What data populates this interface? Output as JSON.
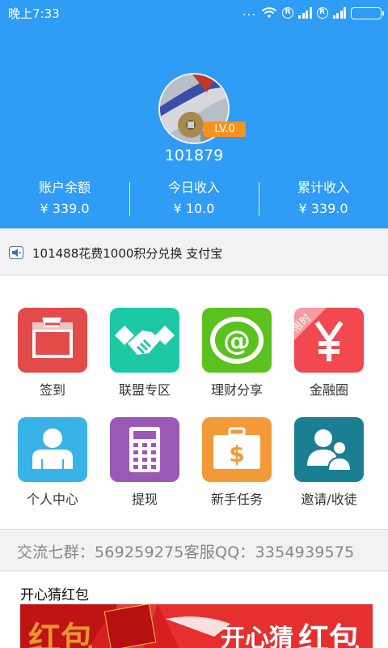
{
  "status_bar": {
    "time": "晚上7:33",
    "dots": "...",
    "r_mark": "R",
    "icons": [
      "wifi-icon",
      "signal-icon",
      "battery-icon"
    ]
  },
  "profile": {
    "level": "LV.0",
    "user_id": "101879"
  },
  "stats": [
    {
      "label": "账户余额",
      "value": "¥ 339.0"
    },
    {
      "label": "今日收入",
      "value": "¥ 10.0"
    },
    {
      "label": "累计收入",
      "value": "¥ 339.0"
    }
  ],
  "notice": {
    "text": "101488花费1000积分兑换 支付宝"
  },
  "menu": [
    {
      "label": "签到",
      "color": "#e34a4a",
      "icon": "checkin-icon"
    },
    {
      "label": "联盟专区",
      "color": "#1dc9a4",
      "icon": "handshake-icon"
    },
    {
      "label": "理财分享",
      "color": "#5ac11e",
      "icon": "at-icon"
    },
    {
      "label": "金融圈",
      "color": "#f2484f",
      "icon": "yen-icon",
      "badge": "限时"
    },
    {
      "label": "个人中心",
      "color": "#38b3e8",
      "icon": "person-icon"
    },
    {
      "label": "提现",
      "color": "#9b59b6",
      "icon": "calculator-icon"
    },
    {
      "label": "新手任务",
      "color": "#f29a38",
      "icon": "money-briefcase-icon"
    },
    {
      "label": "邀请/收徒",
      "color": "#1b7f93",
      "icon": "users-icon"
    }
  ],
  "group_info": "交流七群：569259275客服QQ：3354939575",
  "red_packet": {
    "title": "开心猜红包",
    "banner_text": "开心猜",
    "banner_big": "红包"
  },
  "colors": {
    "header_bg": "#2f9cf6",
    "badge": "#f7921e"
  }
}
